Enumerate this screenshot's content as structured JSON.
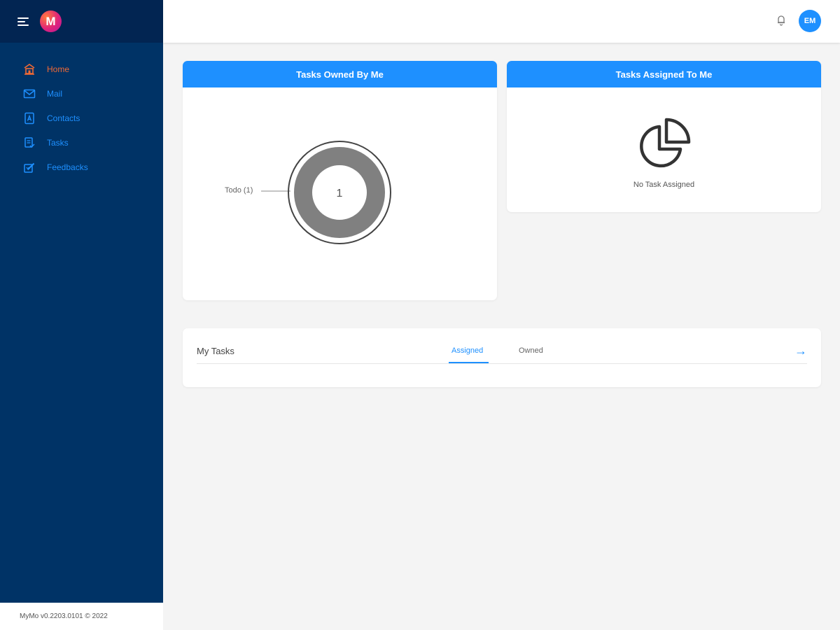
{
  "sidebar": {
    "logo_letter": "M",
    "items": [
      {
        "label": "Home",
        "icon": "home-icon",
        "active": true
      },
      {
        "label": "Mail",
        "icon": "mail-icon",
        "active": false
      },
      {
        "label": "Contacts",
        "icon": "contacts-icon",
        "active": false
      },
      {
        "label": "Tasks",
        "icon": "tasks-icon",
        "active": false
      },
      {
        "label": "Feedbacks",
        "icon": "feedback-icon",
        "active": false
      }
    ],
    "footer": "MyMo v0.2203.0101 © 2022"
  },
  "header": {
    "avatar_initials": "EM"
  },
  "owned_card": {
    "title": "Tasks Owned By Me",
    "chart_data": {
      "type": "pie",
      "categories": [
        "Todo"
      ],
      "values": [
        1
      ],
      "center_label": "1",
      "slice_label": "Todo (1)"
    }
  },
  "assigned_card": {
    "title": "Tasks Assigned To Me",
    "empty_text": "No Task Assigned"
  },
  "my_tasks": {
    "title": "My Tasks",
    "tabs": [
      {
        "label": "Assigned",
        "active": true
      },
      {
        "label": "Owned",
        "active": false
      }
    ],
    "arrow": "→"
  },
  "colors": {
    "sidebar_bg": "#003366",
    "accent": "#1e90ff",
    "active_nav": "#f06a35",
    "donut": "#808080"
  }
}
